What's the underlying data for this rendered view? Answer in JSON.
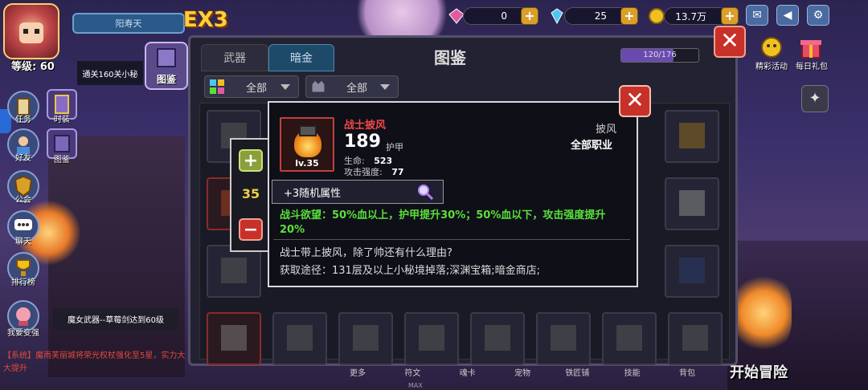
{
  "player": {
    "level_label": "等级: 60",
    "name": "阳寿天",
    "ex_badge": "EX3"
  },
  "quest_tip": "通关160关小秘",
  "codex_shortcut": {
    "label": "图鉴"
  },
  "side_menu": [
    {
      "label": "任务",
      "icon": "scroll-icon"
    },
    {
      "label": "时装",
      "icon": "armor-icon"
    },
    {
      "label": "好友",
      "icon": "friend-icon"
    },
    {
      "label": "图鉴",
      "icon": "book-icon"
    },
    {
      "label": "公会",
      "icon": "shield-icon"
    },
    {
      "label": "聊天",
      "icon": "chat-icon"
    },
    {
      "label": "排行榜",
      "icon": "trophy-icon"
    },
    {
      "label": "我要变强",
      "icon": "power-up-icon"
    }
  ],
  "notice": "魔女武器--草莓剑达到60级",
  "system_message": "【系统】魔雨芙丽城将荣光权杖强化至5星，实力大大提升",
  "currencies": [
    {
      "name": "pink-gem",
      "value": "0",
      "color": "#e05aa0"
    },
    {
      "name": "diamond",
      "value": "25",
      "color": "#4ac8f0"
    },
    {
      "name": "gold",
      "value": "13.7万",
      "color": "#f0c020"
    }
  ],
  "top_icons": [
    "mail-icon",
    "speaker-icon",
    "settings-icon"
  ],
  "rewards": [
    {
      "label": "精彩活动"
    },
    {
      "label": "每日礼包"
    }
  ],
  "codex": {
    "tabs": [
      {
        "label": "武器",
        "active": false
      },
      {
        "label": "暗金",
        "active": true
      }
    ],
    "title": "图鉴",
    "progress_text": "120/176",
    "progress_fraction": 0.682,
    "filters": [
      {
        "label": "全部",
        "icon": "grid-icon"
      },
      {
        "label": "全部",
        "icon": "monster-icon"
      }
    ]
  },
  "detail": {
    "quantity": "35",
    "item_name": "战士披风",
    "item_level": "lv.35",
    "power": "189",
    "power_unit": "护甲",
    "stats": [
      {
        "label": "生命:",
        "value": "523"
      },
      {
        "label": "攻击强度:",
        "value": "77"
      }
    ],
    "type": "披风",
    "class": "全部职业",
    "random_attr": "+3随机属性",
    "skill": "战斗欲望：50%血以上，护甲提升30%；50%血以下，攻击强度提升20%",
    "flavor": "战士带上披风，除了帅还有什么理由?",
    "source": "获取途径：131层及以上小秘境掉落;深渊宝箱;暗金商店;"
  },
  "bottom_nav": [
    "更多",
    "符文",
    "魂卡",
    "宠物",
    "铁匠铺",
    "技能",
    "背包"
  ],
  "max_label": "MAX",
  "start_button": "开始冒险"
}
